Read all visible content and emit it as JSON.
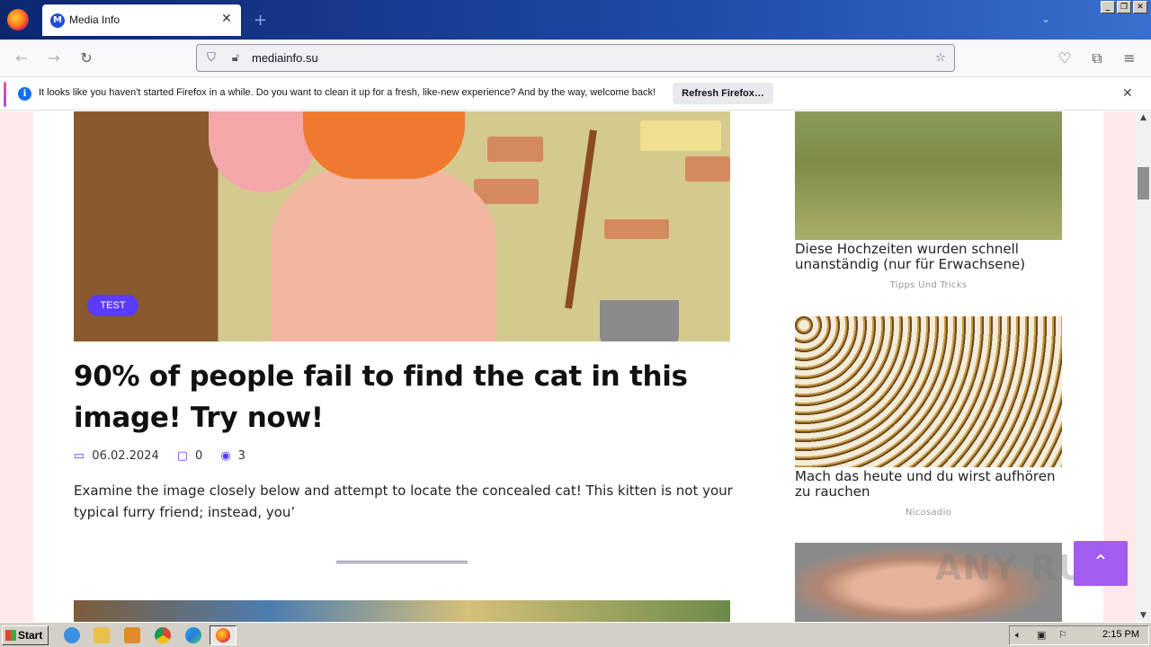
{
  "browser": {
    "tab_title": "Media Info",
    "tab_favicon_letter": "M",
    "url": "mediainfo.su",
    "window_controls": [
      "_",
      "❐",
      "✕"
    ]
  },
  "notification": {
    "text": "It looks like you haven't started Firefox in a while. Do you want to clean it up for a fresh, like-new experience? And by the way, welcome back!",
    "button_label": "Refresh Firefox…"
  },
  "article": {
    "category_badge": "TEST",
    "title": "90% of people fail to find the cat in this image! Try now!",
    "date": "06.02.2024",
    "comments": "0",
    "views": "3",
    "excerpt": "Examine the image closely below and attempt to locate the concealed cat! This kitten is not your typical furry friend; instead, you’"
  },
  "sidebar": {
    "ads": [
      {
        "title": "Diese Hochzeiten wurden schnell unanständig (nur für Erwachsene)",
        "source": "Tipps Und Tricks"
      },
      {
        "title": "Mach das heute und du wirst aufhören zu rauchen",
        "source": "Nicosadio"
      }
    ]
  },
  "watermark": "ANY RUN",
  "taskbar": {
    "start_label": "Start",
    "clock": "2:15 PM"
  },
  "colors": {
    "accent": "#5b3bff",
    "scrolltop": "#a45bf0",
    "page_bg": "#fde9ea"
  }
}
